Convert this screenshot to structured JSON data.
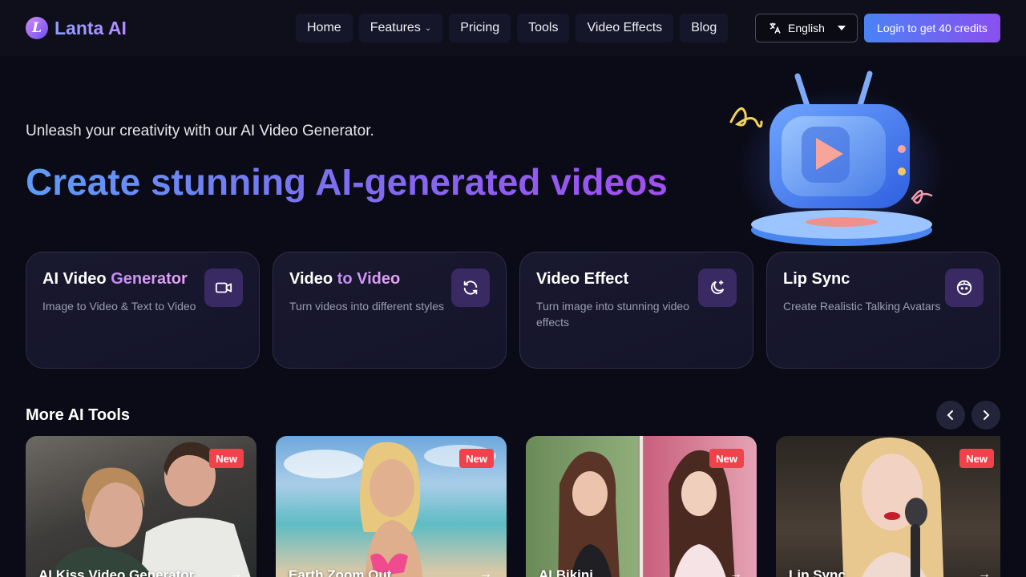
{
  "brand": {
    "name": "Lanta AI",
    "logo_letter": "L"
  },
  "nav": [
    {
      "label": "Home"
    },
    {
      "label": "Features",
      "has_dropdown": true
    },
    {
      "label": "Pricing"
    },
    {
      "label": "Tools"
    },
    {
      "label": "Video Effects"
    },
    {
      "label": "Blog"
    }
  ],
  "language": {
    "label": "English",
    "icon": "translate-icon"
  },
  "login": {
    "label": "Login to get 40 credits"
  },
  "hero": {
    "tagline": "Unleash your creativity with our AI Video Generator.",
    "headline": "Create stunning AI-generated videos"
  },
  "features": [
    {
      "title_a": "AI Video ",
      "title_b": "Generator",
      "desc": "Image to Video & Text to Video",
      "icon": "video-camera-icon"
    },
    {
      "title_a": "Video ",
      "title_b": "to Video",
      "desc": "Turn videos into different styles",
      "icon": "refresh-icon"
    },
    {
      "title_a": "Video Effect",
      "title_b": "",
      "desc": "Turn image into stunning video effects",
      "icon": "moon-sparkle-icon"
    },
    {
      "title_a": "Lip Sync",
      "title_b": "",
      "desc": "Create Realistic Talking Avatars",
      "icon": "face-icon"
    }
  ],
  "more_tools": {
    "title": "More AI Tools",
    "items": [
      {
        "name": "AI Kiss Video Generator",
        "badge": "New"
      },
      {
        "name": "Earth Zoom Out",
        "badge": "New"
      },
      {
        "name": "AI Bikini",
        "badge": "New"
      },
      {
        "name": "Lip Sync",
        "badge": "New"
      }
    ]
  },
  "colors": {
    "accent_start": "#4b82f5",
    "accent_end": "#8a4ff0",
    "badge": "#f0424a",
    "background": "#0b0b17"
  }
}
